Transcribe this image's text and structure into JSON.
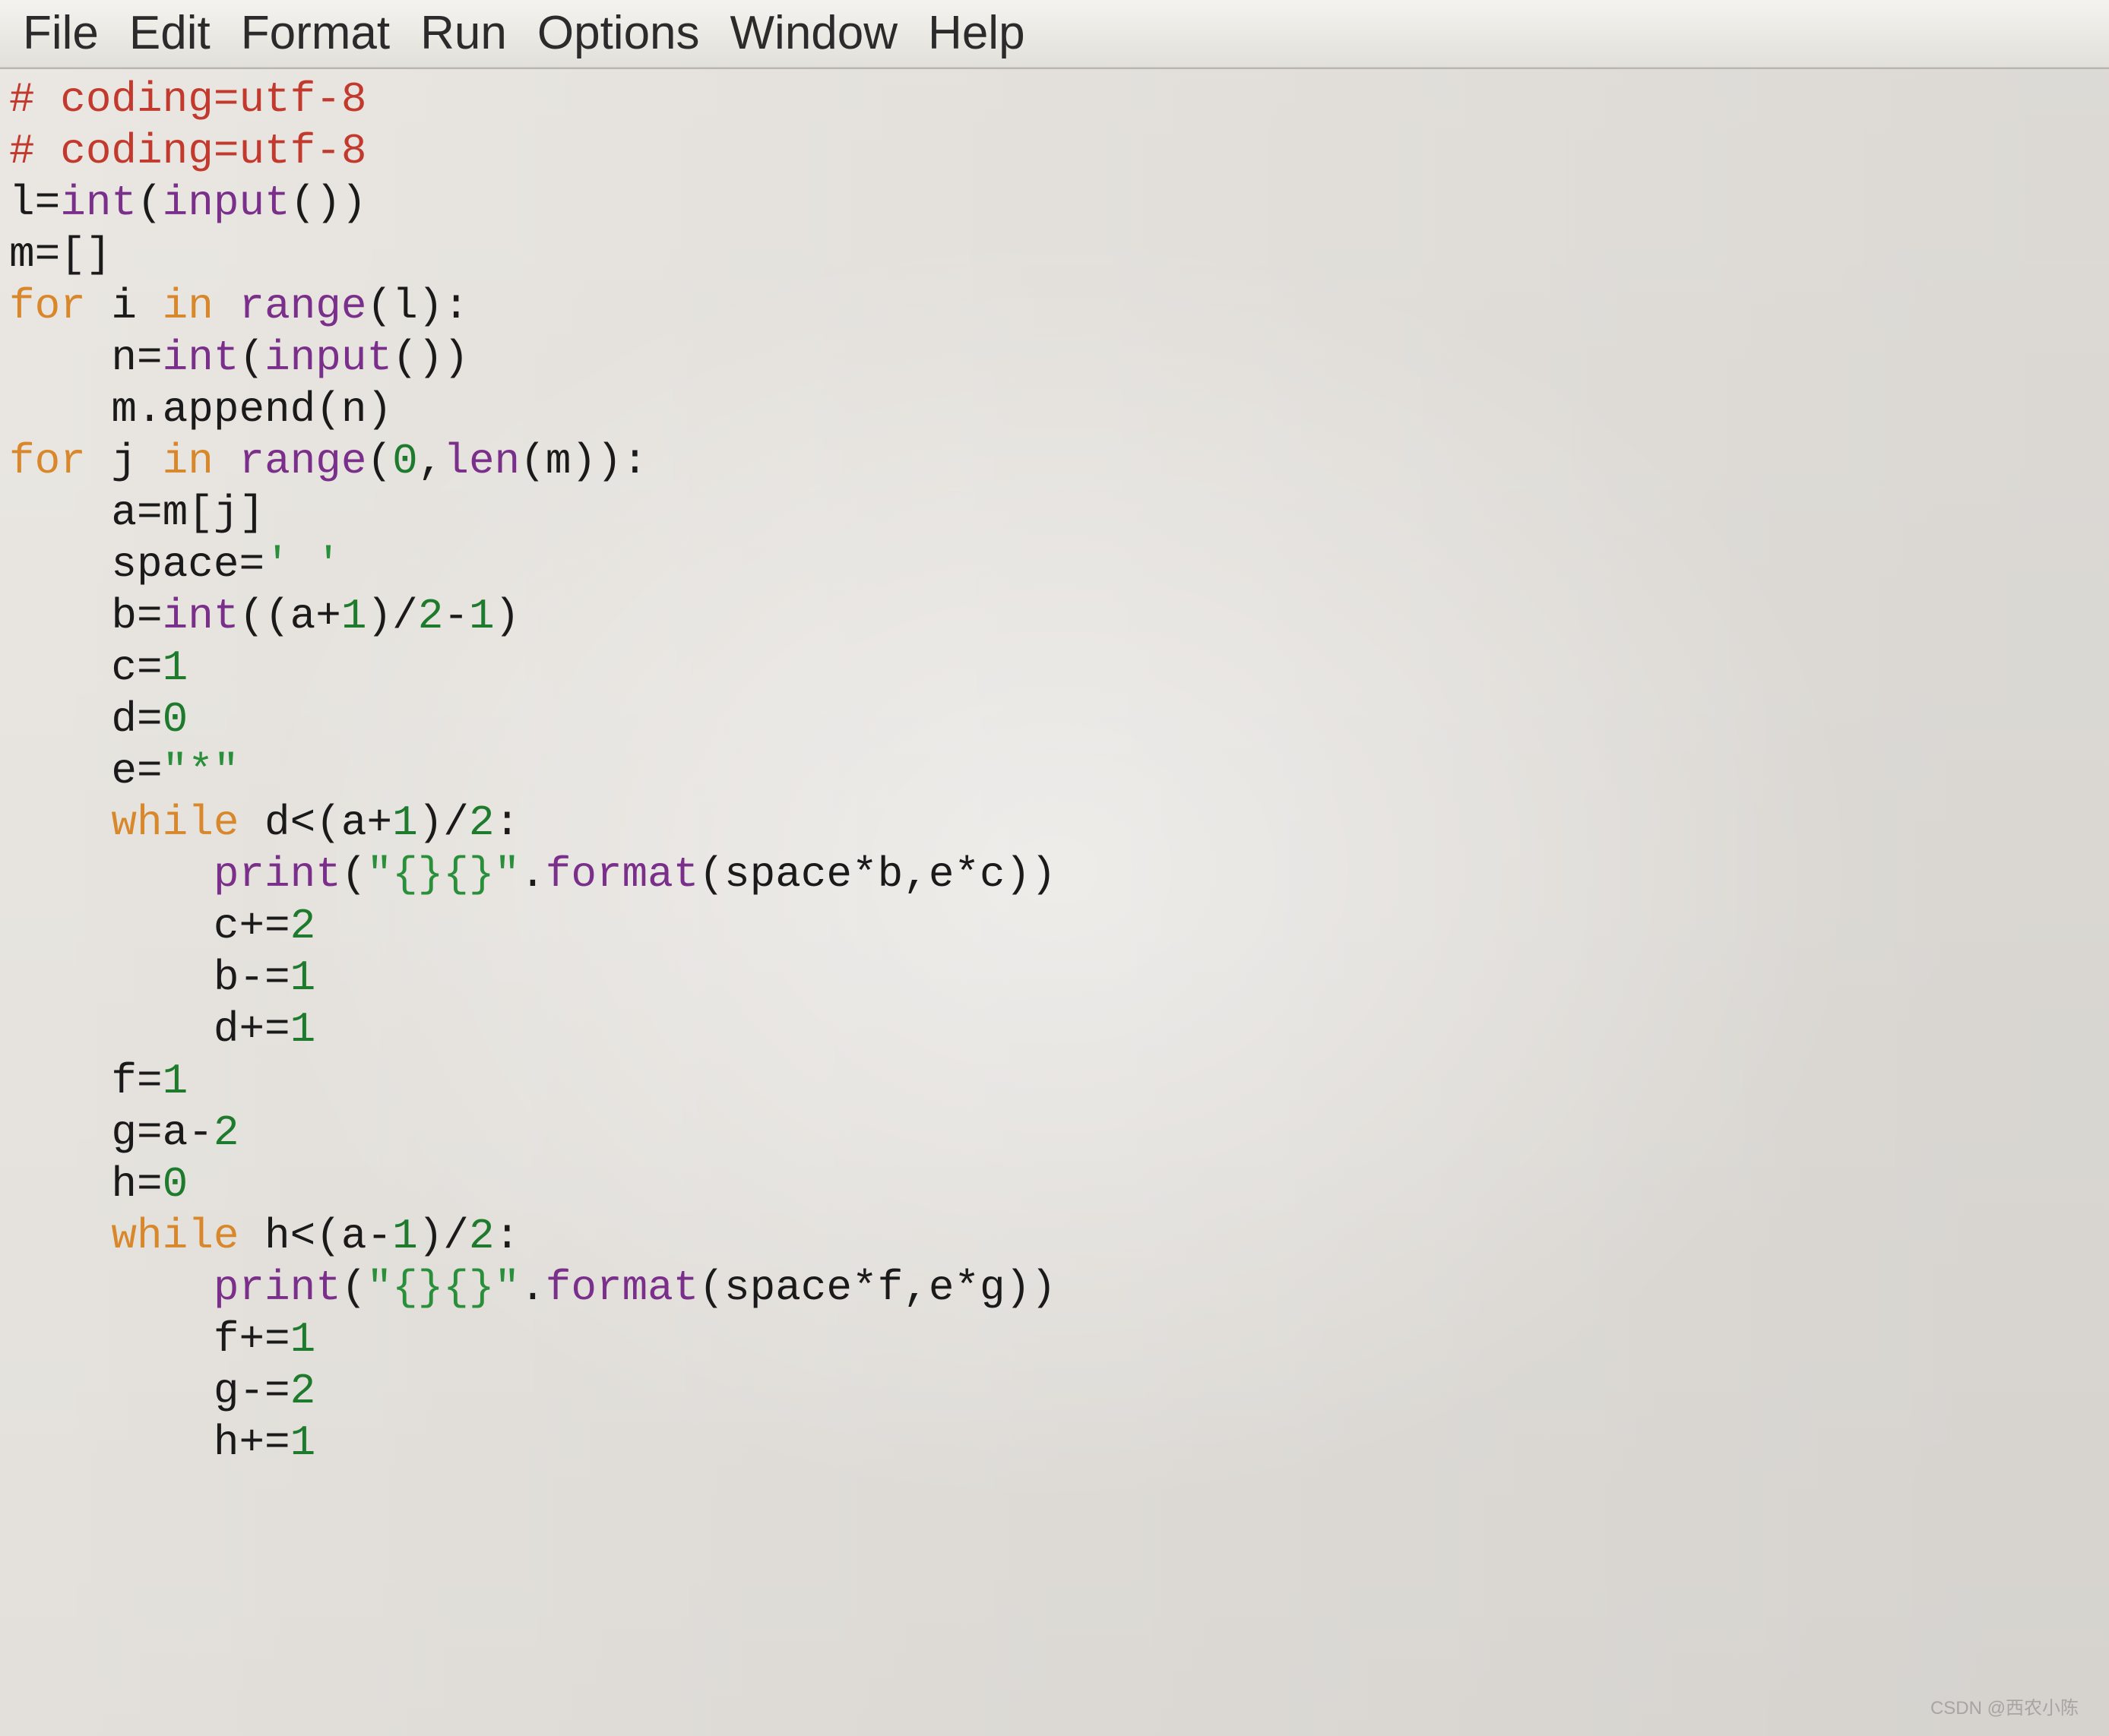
{
  "menu": {
    "file": "File",
    "edit": "Edit",
    "format": "Format",
    "run": "Run",
    "options": "Options",
    "window": "Window",
    "help": "Help"
  },
  "code": {
    "l1_comment": "# coding=utf-8",
    "l2_comment": "# coding=utf-8",
    "l3_a": "l=",
    "l3_b": "int",
    "l3_c": "(",
    "l3_d": "input",
    "l3_e": "())",
    "l4": "m=[]",
    "l5_a": "for",
    "l5_b": " i ",
    "l5_c": "in",
    "l5_d": " ",
    "l5_e": "range",
    "l5_f": "(l):",
    "l6_a": "    n=",
    "l6_b": "int",
    "l6_c": "(",
    "l6_d": "input",
    "l6_e": "())",
    "l7": "    m.append(n)",
    "l8_a": "for",
    "l8_b": " j ",
    "l8_c": "in",
    "l8_d": " ",
    "l8_e": "range",
    "l8_f": "(",
    "l8_g": "0",
    "l8_h": ",",
    "l8_i": "len",
    "l8_j": "(m)):",
    "l9": "    a=m[j]",
    "l10_a": "    space=",
    "l10_b": "' '",
    "l11_a": "    b=",
    "l11_b": "int",
    "l11_c": "((a+",
    "l11_d": "1",
    "l11_e": ")/",
    "l11_f": "2",
    "l11_g": "-",
    "l11_h": "1",
    "l11_i": ")",
    "l12_a": "    c=",
    "l12_b": "1",
    "l13_a": "    d=",
    "l13_b": "0",
    "l14_a": "    e=",
    "l14_b": "\"*\"",
    "l15_a": "    ",
    "l15_b": "while",
    "l15_c": " d<(a+",
    "l15_d": "1",
    "l15_e": ")/",
    "l15_f": "2",
    "l15_g": ":",
    "l16_a": "        ",
    "l16_b": "print",
    "l16_c": "(",
    "l16_d": "\"{}{}\"",
    "l16_e": ".",
    "l16_f": "format",
    "l16_g": "(space*b,e*c))",
    "l17_a": "        c+=",
    "l17_b": "2",
    "l18_a": "        b-=",
    "l18_b": "1",
    "l19_a": "        d+=",
    "l19_b": "1",
    "l20_a": "    f=",
    "l20_b": "1",
    "l21_a": "    g=a-",
    "l21_b": "2",
    "l22_a": "    h=",
    "l22_b": "0",
    "l23_a": "    ",
    "l23_b": "while",
    "l23_c": " h<(a-",
    "l23_d": "1",
    "l23_e": ")/",
    "l23_f": "2",
    "l23_g": ":",
    "l24_a": "        ",
    "l24_b": "print",
    "l24_c": "(",
    "l24_d": "\"{}{}\"",
    "l24_e": ".",
    "l24_f": "format",
    "l24_g": "(space*f,e*g))",
    "l25_a": "        f+=",
    "l25_b": "1",
    "l26_a": "        g-=",
    "l26_b": "2",
    "l27_a": "        h+=",
    "l27_b": "1"
  },
  "watermark": "CSDN @西农小陈"
}
